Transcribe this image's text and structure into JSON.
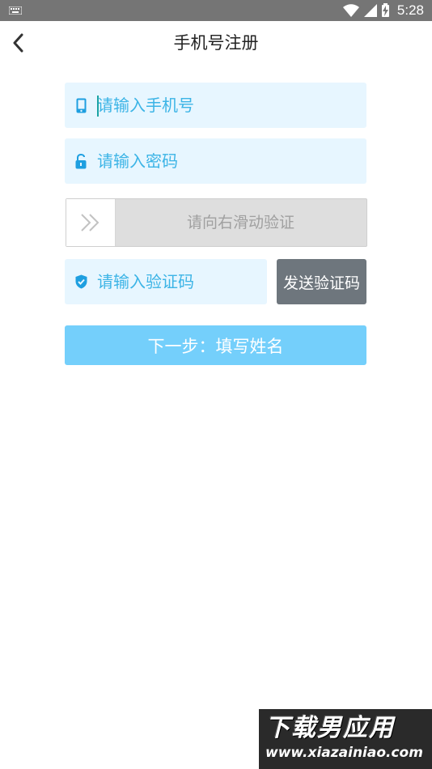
{
  "status_bar": {
    "time": "5:28",
    "icons": [
      "keyboard-icon",
      "wifi-icon",
      "signal-icon",
      "battery-charging-icon"
    ]
  },
  "header": {
    "title": "手机号注册",
    "back_icon": "chevron-left-icon"
  },
  "form": {
    "phone": {
      "placeholder": "请输入手机号",
      "value": "",
      "icon": "phone-icon"
    },
    "password": {
      "placeholder": "请输入密码",
      "value": "",
      "icon": "lock-icon"
    },
    "slider": {
      "label": "请向右滑动验证",
      "icon": "double-chevron-right-icon"
    },
    "code": {
      "placeholder": "请输入验证码",
      "value": "",
      "icon": "shield-check-icon"
    },
    "send_code_label": "发送验证码",
    "next_label": "下一步：填写姓名"
  },
  "watermark": {
    "title": "下载男应用",
    "url": "www.xiazainiao.com"
  },
  "colors": {
    "accent": "#3cb4e6",
    "field_bg": "#e7f6ff",
    "send_btn": "#6e767d",
    "next_btn": "#74cffb",
    "status_bar": "#757575"
  }
}
